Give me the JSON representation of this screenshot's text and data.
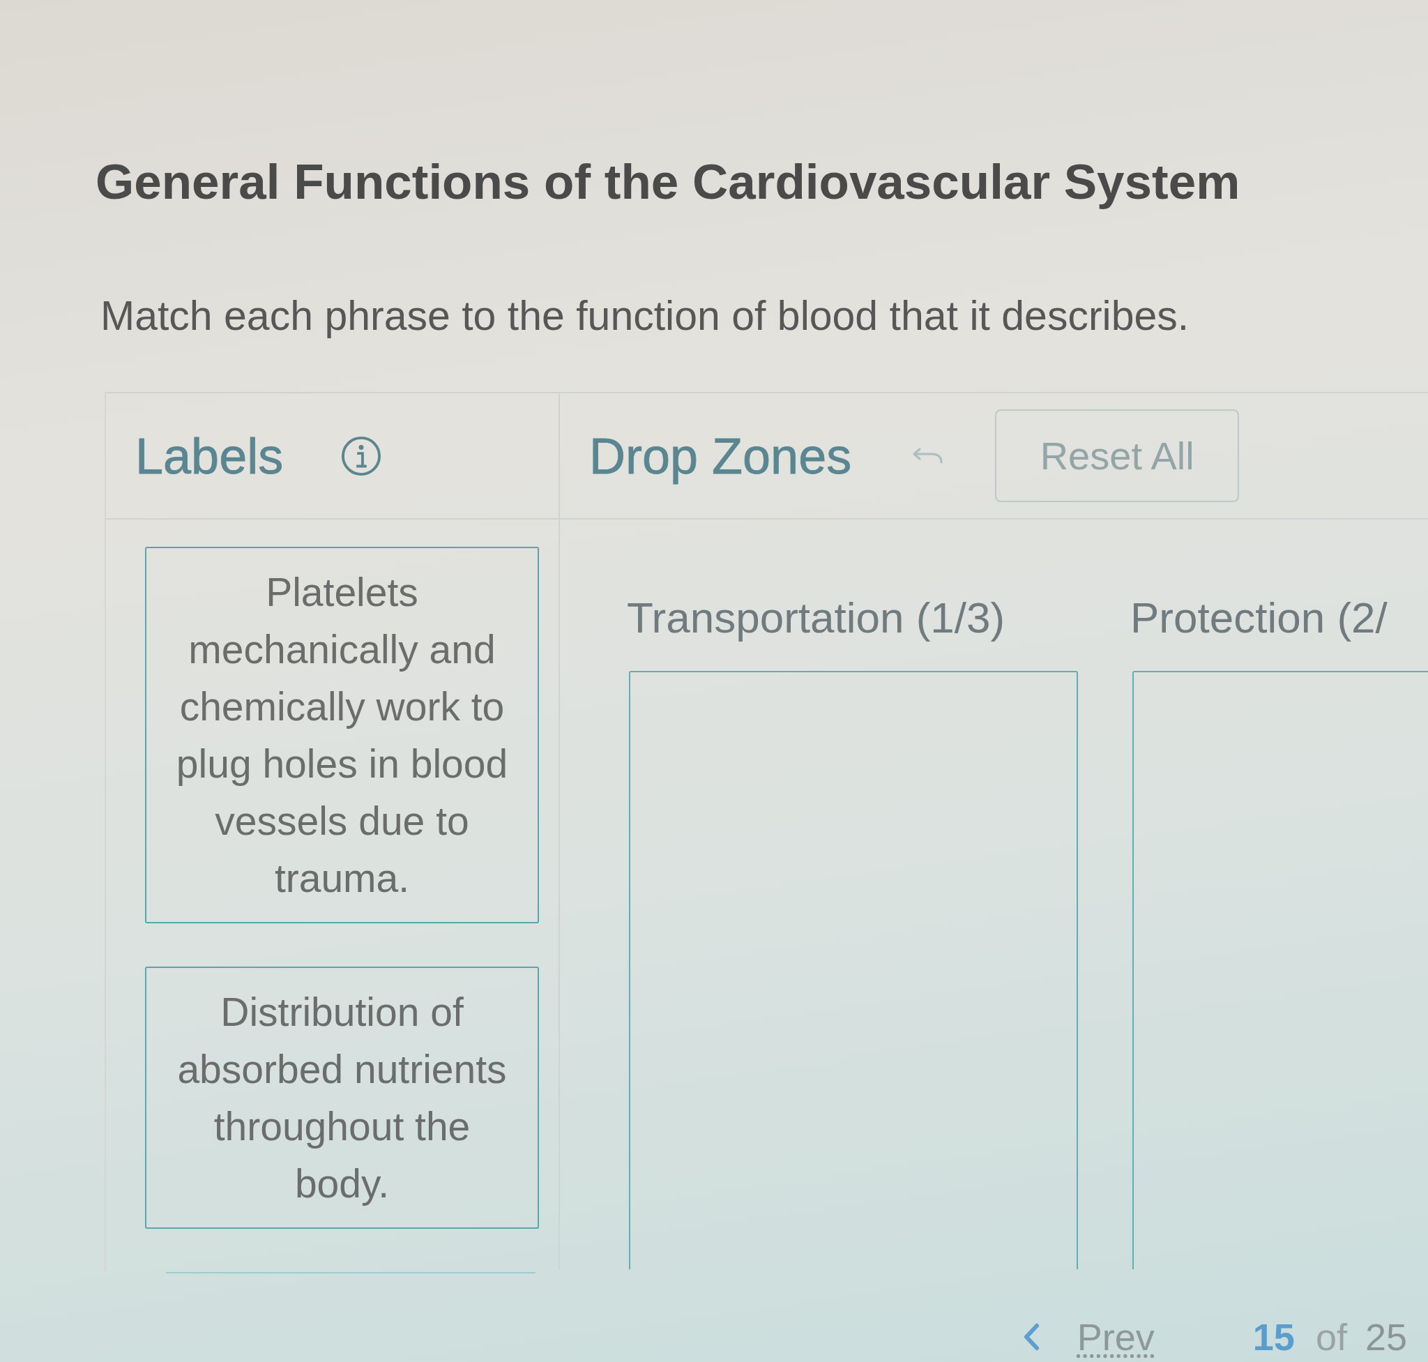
{
  "title": "General Functions of the Cardiovascular System",
  "instructions": "Match each phrase to the function of blood that it describes.",
  "labels_panel": {
    "heading": "Labels",
    "cards": [
      {
        "text": "Platelets mechanically and chemically work to plug holes in blood vessels due to trauma."
      },
      {
        "text": "Distribution of absorbed nutrients throughout the body."
      }
    ]
  },
  "drop_zones_panel": {
    "heading": "Drop Zones",
    "undo": {
      "disabled": true
    },
    "reset_button": {
      "label": "Reset All",
      "disabled": true
    },
    "zones": [
      {
        "title": "Transportation (1/3)"
      },
      {
        "title": "Protection (2/"
      }
    ]
  },
  "pagination": {
    "prev": "Prev",
    "current": "15",
    "separator": "of",
    "total": "25"
  }
}
